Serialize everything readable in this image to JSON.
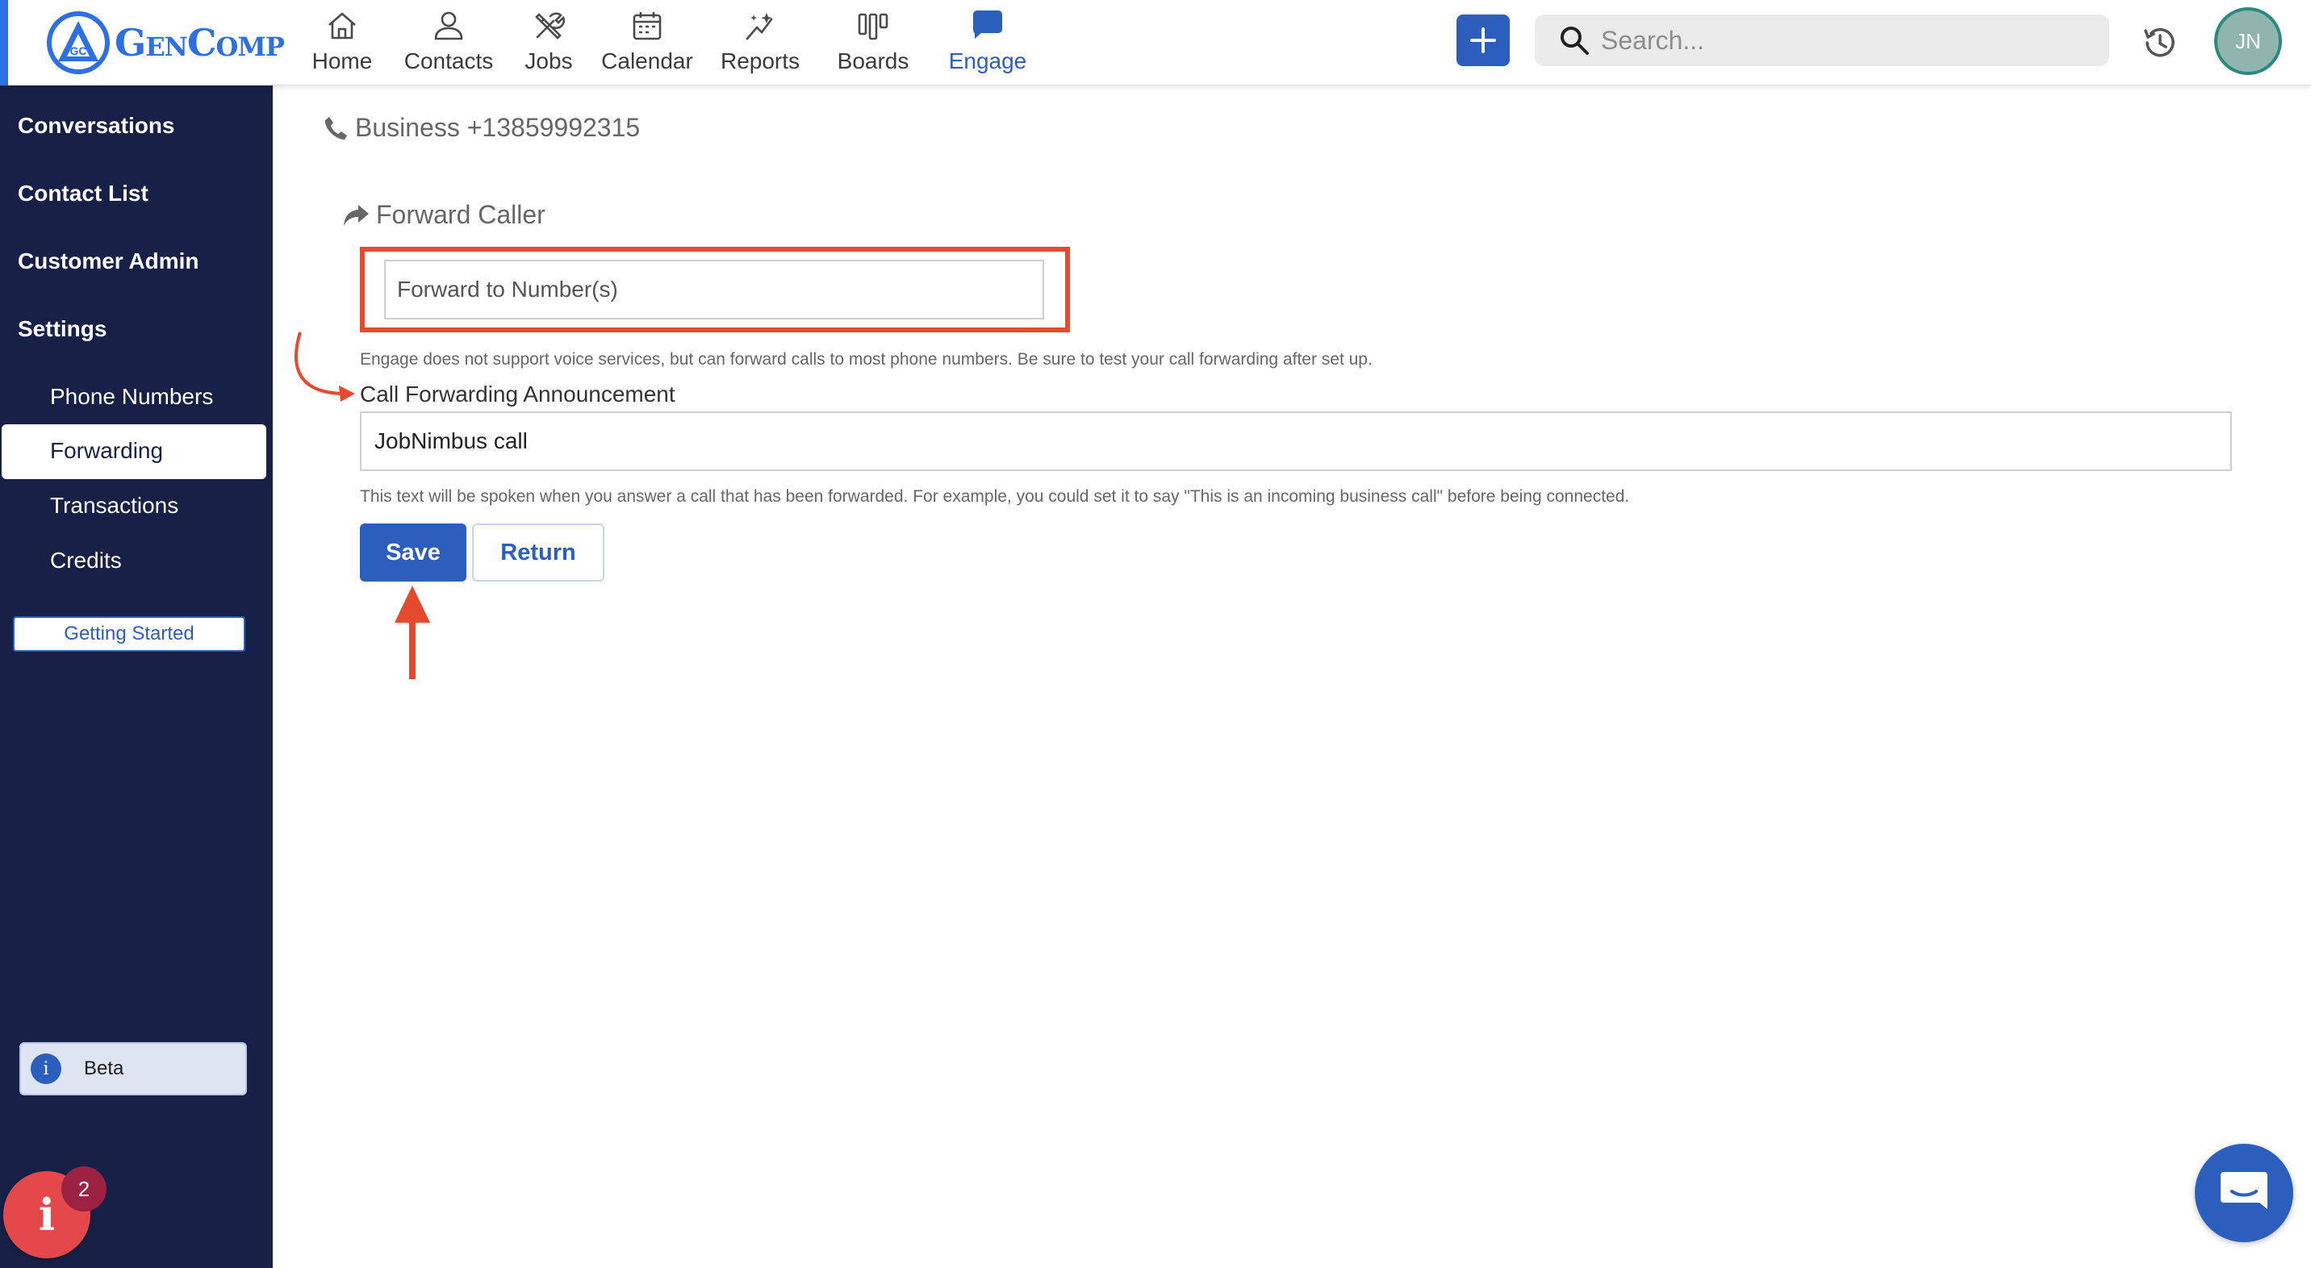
{
  "header": {
    "logo_text": "GenComp",
    "nav": [
      {
        "label": "Home",
        "icon": "home-icon"
      },
      {
        "label": "Contacts",
        "icon": "contacts-icon"
      },
      {
        "label": "Jobs",
        "icon": "jobs-icon"
      },
      {
        "label": "Calendar",
        "icon": "calendar-icon"
      },
      {
        "label": "Reports",
        "icon": "reports-icon"
      },
      {
        "label": "Boards",
        "icon": "boards-icon"
      },
      {
        "label": "Engage",
        "icon": "engage-icon",
        "active": true
      }
    ],
    "search_placeholder": "Search...",
    "avatar_initials": "JN"
  },
  "sidebar": {
    "items": [
      {
        "label": "Conversations"
      },
      {
        "label": "Contact List"
      },
      {
        "label": "Customer Admin"
      },
      {
        "label": "Settings"
      }
    ],
    "sub_items": [
      {
        "label": "Phone Numbers"
      },
      {
        "label": "Forwarding",
        "active": true
      },
      {
        "label": "Transactions"
      },
      {
        "label": "Credits"
      }
    ],
    "getting_started": "Getting Started",
    "beta_label": "Beta",
    "info_badge_count": "2",
    "info_icon_glyph": "i"
  },
  "main": {
    "business_line": "Business +13859992315",
    "section_title": "Forward Caller",
    "forward_input_placeholder": "Forward to Number(s)",
    "forward_help": "Engage does not support voice services, but can forward calls to most phone numbers. Be sure to test your call forwarding after set up.",
    "announcement_label": "Call Forwarding Announcement",
    "announcement_value": "JobNimbus call",
    "announcement_help": "This text will be spoken when you answer a call that has been forwarded. For example, you could set it to say \"This is an incoming business call\" before being connected.",
    "save_label": "Save",
    "return_label": "Return"
  },
  "colors": {
    "brand_blue": "#2c5fbd",
    "sidebar_bg": "#172046",
    "annotation_red": "#e54a2e",
    "info_fab_red": "#e5484b"
  }
}
